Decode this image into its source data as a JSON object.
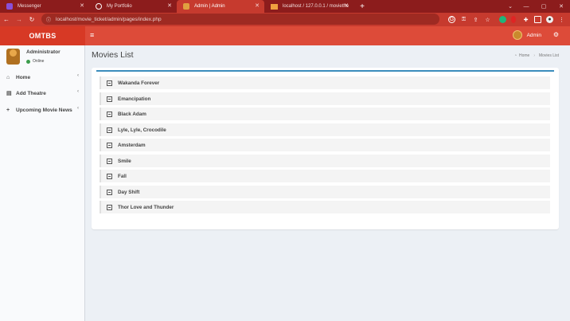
{
  "browser": {
    "tabs": [
      {
        "title": "Messenger",
        "icon": "messenger-icon",
        "color": "#8a4fd8"
      },
      {
        "title": "My Portfolio",
        "icon": "globe-icon",
        "color": "#ffffff"
      },
      {
        "title": "Admin | Admin",
        "icon": "page-icon",
        "color": "#e0a040"
      },
      {
        "title": "localhost / 127.0.0.1 / moviethe",
        "icon": "phpmyadmin-icon",
        "color": "#f0a040"
      }
    ],
    "url": "localhost/movie_ticket/admin/pages/index.php"
  },
  "app": {
    "logo": "OMTBS",
    "user_label": "Admin",
    "accent": "#dd4b39"
  },
  "sidebar": {
    "user_name": "Administrator",
    "user_status": "Online",
    "items": [
      {
        "label": "Home",
        "icon": "home-icon"
      },
      {
        "label": "Add Theatre",
        "icon": "film-icon"
      },
      {
        "label": "Upcoming Movie News",
        "icon": "plus-icon"
      }
    ]
  },
  "main": {
    "title": "Movies List",
    "breadcrumb": {
      "home": "Home",
      "current": "Movies List"
    },
    "movies": [
      "Wakanda Forever",
      "Emancipation",
      "Black Adam",
      "Lyle, Lyle, Crocodile",
      "Amsterdam",
      "Smile",
      "Fall",
      "Day Shift",
      "Thor Love and Thunder"
    ]
  }
}
